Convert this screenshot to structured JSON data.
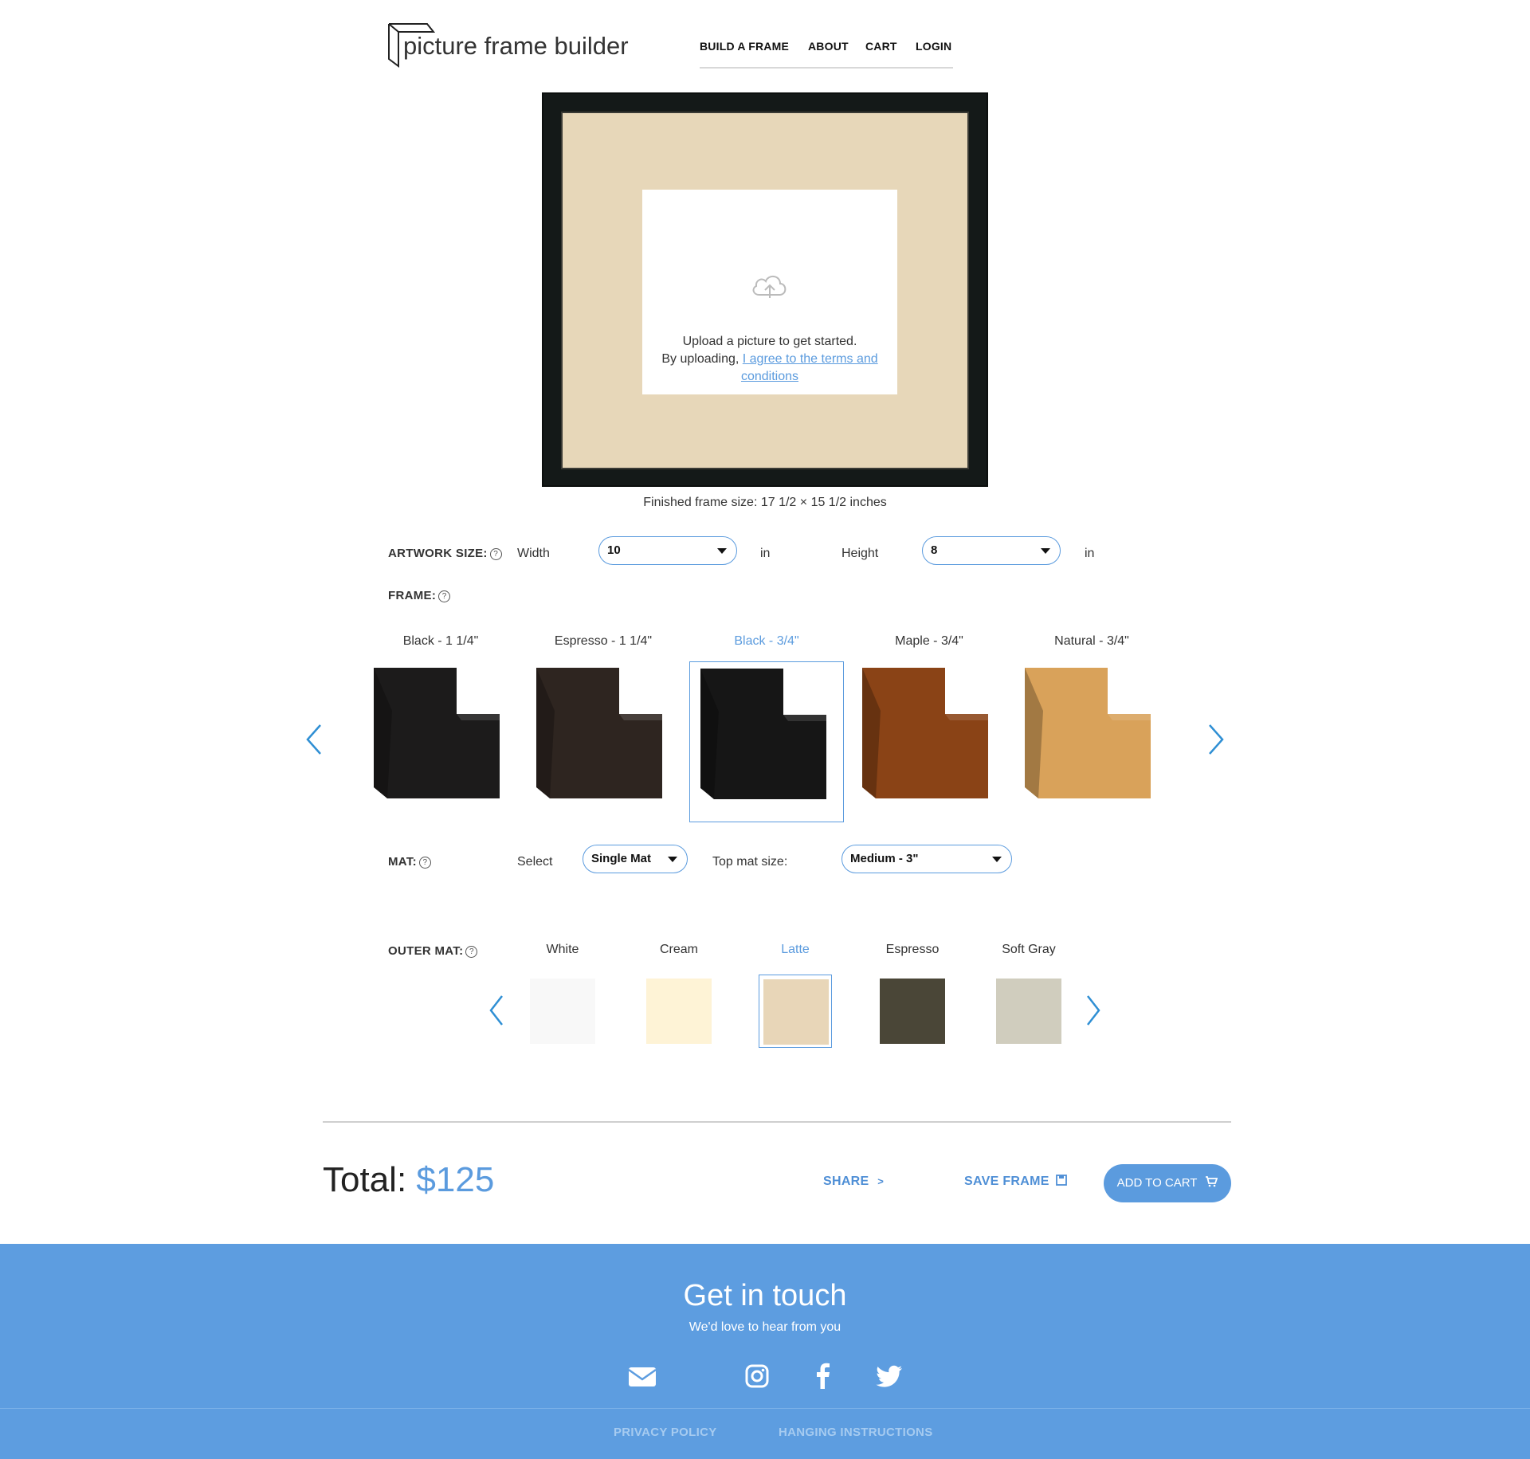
{
  "brand": {
    "name": "picture frame builder"
  },
  "nav": {
    "items": [
      "BUILD A FRAME",
      "ABOUT",
      "CART",
      "LOGIN"
    ]
  },
  "preview": {
    "frame_color": "#141918",
    "mat_color": "#e7d7b9",
    "upload_line1": "Upload a picture to get started.",
    "upload_line2_prefix": "By uploading, ",
    "upload_link": "I agree to the terms and conditions",
    "upload_icon": "cloud-upload-icon",
    "finished_size": "Finished frame size: 17 1/2 × 15 1/2 inches"
  },
  "artwork_size": {
    "label": "ARTWORK SIZE:",
    "help": "?",
    "width_label": "Width",
    "width_value": "10",
    "width_unit": "in",
    "height_label": "Height",
    "height_value": "8",
    "height_unit": "in"
  },
  "frame": {
    "label": "FRAME:",
    "help": "?",
    "options": [
      {
        "name": "Black - 1 1/4\"",
        "color": "#1c1b1b"
      },
      {
        "name": "Espresso - 1 1/4\"",
        "color": "#2e2520"
      },
      {
        "name": "Black - 3/4\"",
        "color": "#161616",
        "selected": true
      },
      {
        "name": "Maple - 3/4\"",
        "color": "#8a4316"
      },
      {
        "name": "Natural - 3/4\"",
        "color": "#d9a25a"
      }
    ]
  },
  "mat": {
    "label": "MAT:",
    "help": "?",
    "select_label": "Select",
    "select_value": "Single Mat",
    "top_size_label": "Top mat size:",
    "top_size_value": "Medium - 3\""
  },
  "outer_mat": {
    "label": "OUTER MAT:",
    "help": "?",
    "options": [
      {
        "name": "White",
        "color": "#f8f8f8"
      },
      {
        "name": "Cream",
        "color": "#fef3d6"
      },
      {
        "name": "Latte",
        "color": "#e8d6b8",
        "selected": true
      },
      {
        "name": "Espresso",
        "color": "#4a4637"
      },
      {
        "name": "Soft Gray",
        "color": "#d0cdbe"
      }
    ]
  },
  "summary": {
    "total_label": "Total:",
    "total_value": "$125",
    "share_label": "SHARE",
    "save_label": "SAVE FRAME",
    "cart_label": "ADD TO CART"
  },
  "footer": {
    "title": "Get in touch",
    "subtitle": "We'd love to hear from you",
    "icons": [
      "email-icon",
      "instagram-icon",
      "facebook-icon",
      "twitter-icon"
    ],
    "links": [
      "PRIVACY POLICY",
      "HANGING INSTRUCTIONS"
    ],
    "background": "#5d9de0"
  },
  "colors": {
    "accent": "#5b9bde"
  }
}
